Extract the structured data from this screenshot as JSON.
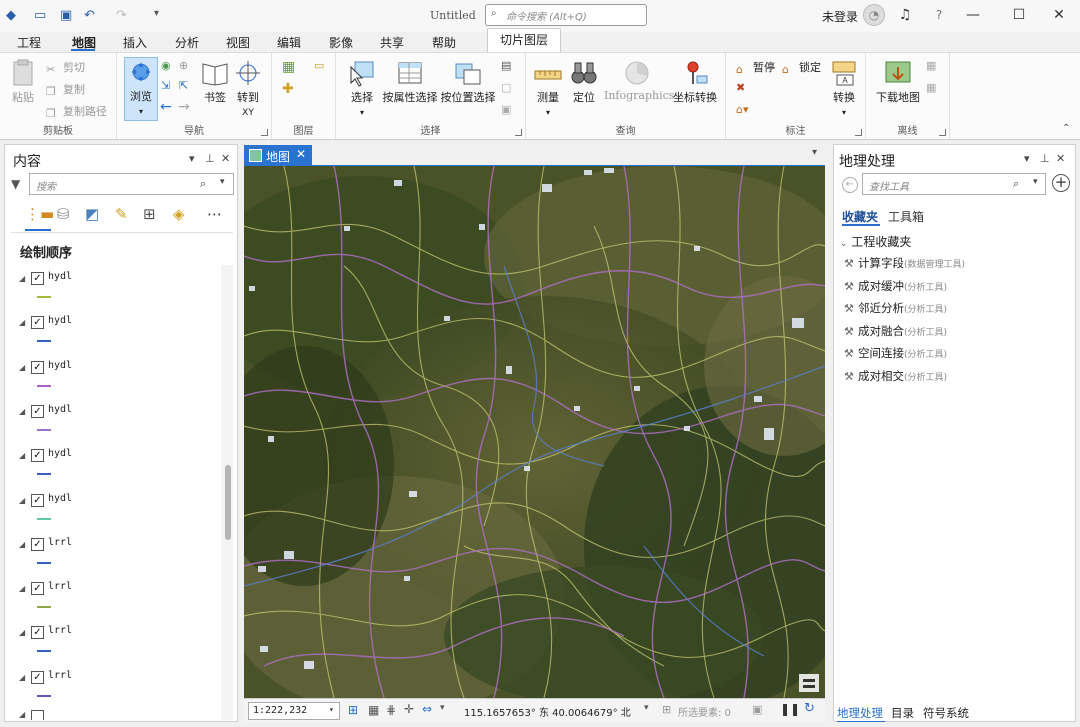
{
  "titlebar": {
    "app_title": "Untitled",
    "command_search_placeholder": "命令搜索 (Alt+Q)",
    "user": "未登录"
  },
  "menu_tabs": [
    "工程",
    "地图",
    "插入",
    "分析",
    "视图",
    "编辑",
    "影像",
    "共享",
    "帮助"
  ],
  "active_tab": "地图",
  "contextual_tab": "切片图层",
  "ribbon": {
    "clipboard": {
      "paste": "粘贴",
      "cut": "剪切",
      "copy": "复制",
      "copy_path": "复制路径",
      "label": "剪贴板"
    },
    "navigate": {
      "explore": "浏览",
      "bookmarks": "书签",
      "goto_xy": "转到",
      "goto_xy_sub": "XY",
      "label": "导航"
    },
    "layer": {
      "label": "图层"
    },
    "selection": {
      "select": "选择",
      "by_attr": "按属性选择",
      "by_location": "按位置选择",
      "label": "选择"
    },
    "inquiry": {
      "measure": "测量",
      "locate": "定位",
      "infographics": "Infographics",
      "coord_convert": "坐标转换",
      "label": "查询"
    },
    "labeling": {
      "pause": "暂停",
      "lock": "锁定",
      "convert": "转换",
      "label": "标注"
    },
    "offline": {
      "download_map": "下载地图",
      "label": "离线"
    }
  },
  "contents_pane": {
    "title": "内容",
    "search_placeholder": "搜索",
    "section": "绘制顺序",
    "layers": [
      {
        "name": "hydl",
        "checked": true,
        "color": "#a4b83a"
      },
      {
        "name": "hydl",
        "checked": true,
        "color": "#3a5fc0"
      },
      {
        "name": "hydl",
        "checked": true,
        "color": "#b060c8"
      },
      {
        "name": "hydl",
        "checked": true,
        "color": "#a070c8"
      },
      {
        "name": "hydl",
        "checked": true,
        "color": "#3a5fc0"
      },
      {
        "name": "hydl",
        "checked": true,
        "color": "#60c8a8"
      },
      {
        "name": "lrrl",
        "checked": true,
        "color": "#3a5fc0"
      },
      {
        "name": "lrrl",
        "checked": true,
        "color": "#8aa848"
      },
      {
        "name": "lrrl",
        "checked": true,
        "color": "#3a5fc0"
      },
      {
        "name": "lrrl",
        "checked": true,
        "color": "#6a50b8"
      }
    ]
  },
  "map_tab": {
    "label": "地图"
  },
  "map_status": {
    "scale": "1:222,232",
    "coordinates": "115.1657653° 东 40.0064679° 北",
    "selected_features": "所选要素: 0"
  },
  "geoprocessing": {
    "title": "地理处理",
    "search_placeholder": "查找工具",
    "tabs": [
      "收藏夹",
      "工具箱"
    ],
    "group": "工程收藏夹",
    "tools": [
      {
        "name": "计算字段",
        "toolbox": "(数据管理工具)"
      },
      {
        "name": "成对缓冲",
        "toolbox": "(分析工具)"
      },
      {
        "name": "邻近分析",
        "toolbox": "(分析工具)"
      },
      {
        "name": "成对融合",
        "toolbox": "(分析工具)"
      },
      {
        "name": "空间连接",
        "toolbox": "(分析工具)"
      },
      {
        "name": "成对相交",
        "toolbox": "(分析工具)"
      }
    ]
  },
  "bottom_tabs": [
    "地理处理",
    "目录",
    "符号系统"
  ],
  "colors": {
    "accent": "#2a73d0",
    "map_base": "#3e4a22"
  }
}
